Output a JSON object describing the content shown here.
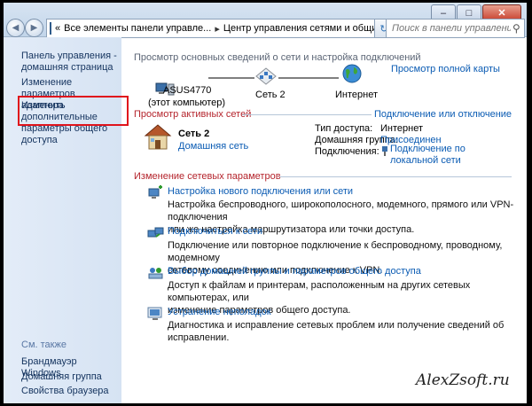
{
  "address": {
    "nav_chevron": "«",
    "crumb1": "Все элементы панели управле...",
    "crumb2": "Центр управления сетями и общим доступом",
    "separator": "▸"
  },
  "search": {
    "placeholder": "Поиск в панели управления"
  },
  "sidebar": {
    "home_line1": "Панель управления -",
    "home_line2": "домашняя страница",
    "adapter_line1": "Изменение параметров",
    "adapter_line2": "адаптера",
    "sharing_line1": "Изменить дополнительные",
    "sharing_line2": "параметры общего доступа",
    "see_also": "См. также",
    "firewall": "Брандмауэр Windows",
    "homegroup": "Домашняя группа",
    "browser": "Свойства браузера"
  },
  "overview": {
    "title": "Просмотр основных сведений о сети и настройка подключений",
    "full_map": "Просмотр полной карты",
    "computer_name": "ASUS4770",
    "computer_sub": "(этот компьютер)",
    "network_name": "Сеть 2",
    "internet": "Интернет"
  },
  "active": {
    "heading": "Просмотр активных сетей",
    "connect_link": "Подключение или отключение",
    "network_title": "Сеть 2",
    "network_type": "Домашняя сеть",
    "access_label": "Тип доступа:",
    "access_value": "Интернет",
    "homegroup_label": "Домашняя группа:",
    "homegroup_value": "Присоединен",
    "connections_label": "Подключения:",
    "connections_value1": "Подключение по",
    "connections_value2": "локальной сети"
  },
  "changes": {
    "heading": "Изменение сетевых параметров",
    "tasks": [
      {
        "title": "Настройка нового подключения или сети",
        "desc1": "Настройка беспроводного, широкополосного, модемного, прямого или VPN-подключения",
        "desc2": "или же настройка маршрутизатора или точки доступа."
      },
      {
        "title": "Подключиться к сети",
        "desc1": "Подключение или повторное подключение к беспроводному, проводному, модемному",
        "desc2": "сетевому соединению или подключение к VPN."
      },
      {
        "title": "Выбор домашней группы и параметров общего доступа",
        "desc1": "Доступ к файлам и принтерам, расположенным на других сетевых компьютерах, или",
        "desc2": "изменение параметров общего доступа."
      },
      {
        "title": "Устранение неполадок",
        "desc1": "Диагностика и исправление сетевых проблем или получение сведений об исправлении.",
        "desc2": ""
      }
    ]
  },
  "watermark": "AlexZsoft.ru",
  "colors": {
    "link": "#0a5bb3",
    "heading": "#b4232b",
    "highlight": "#e0141c"
  }
}
